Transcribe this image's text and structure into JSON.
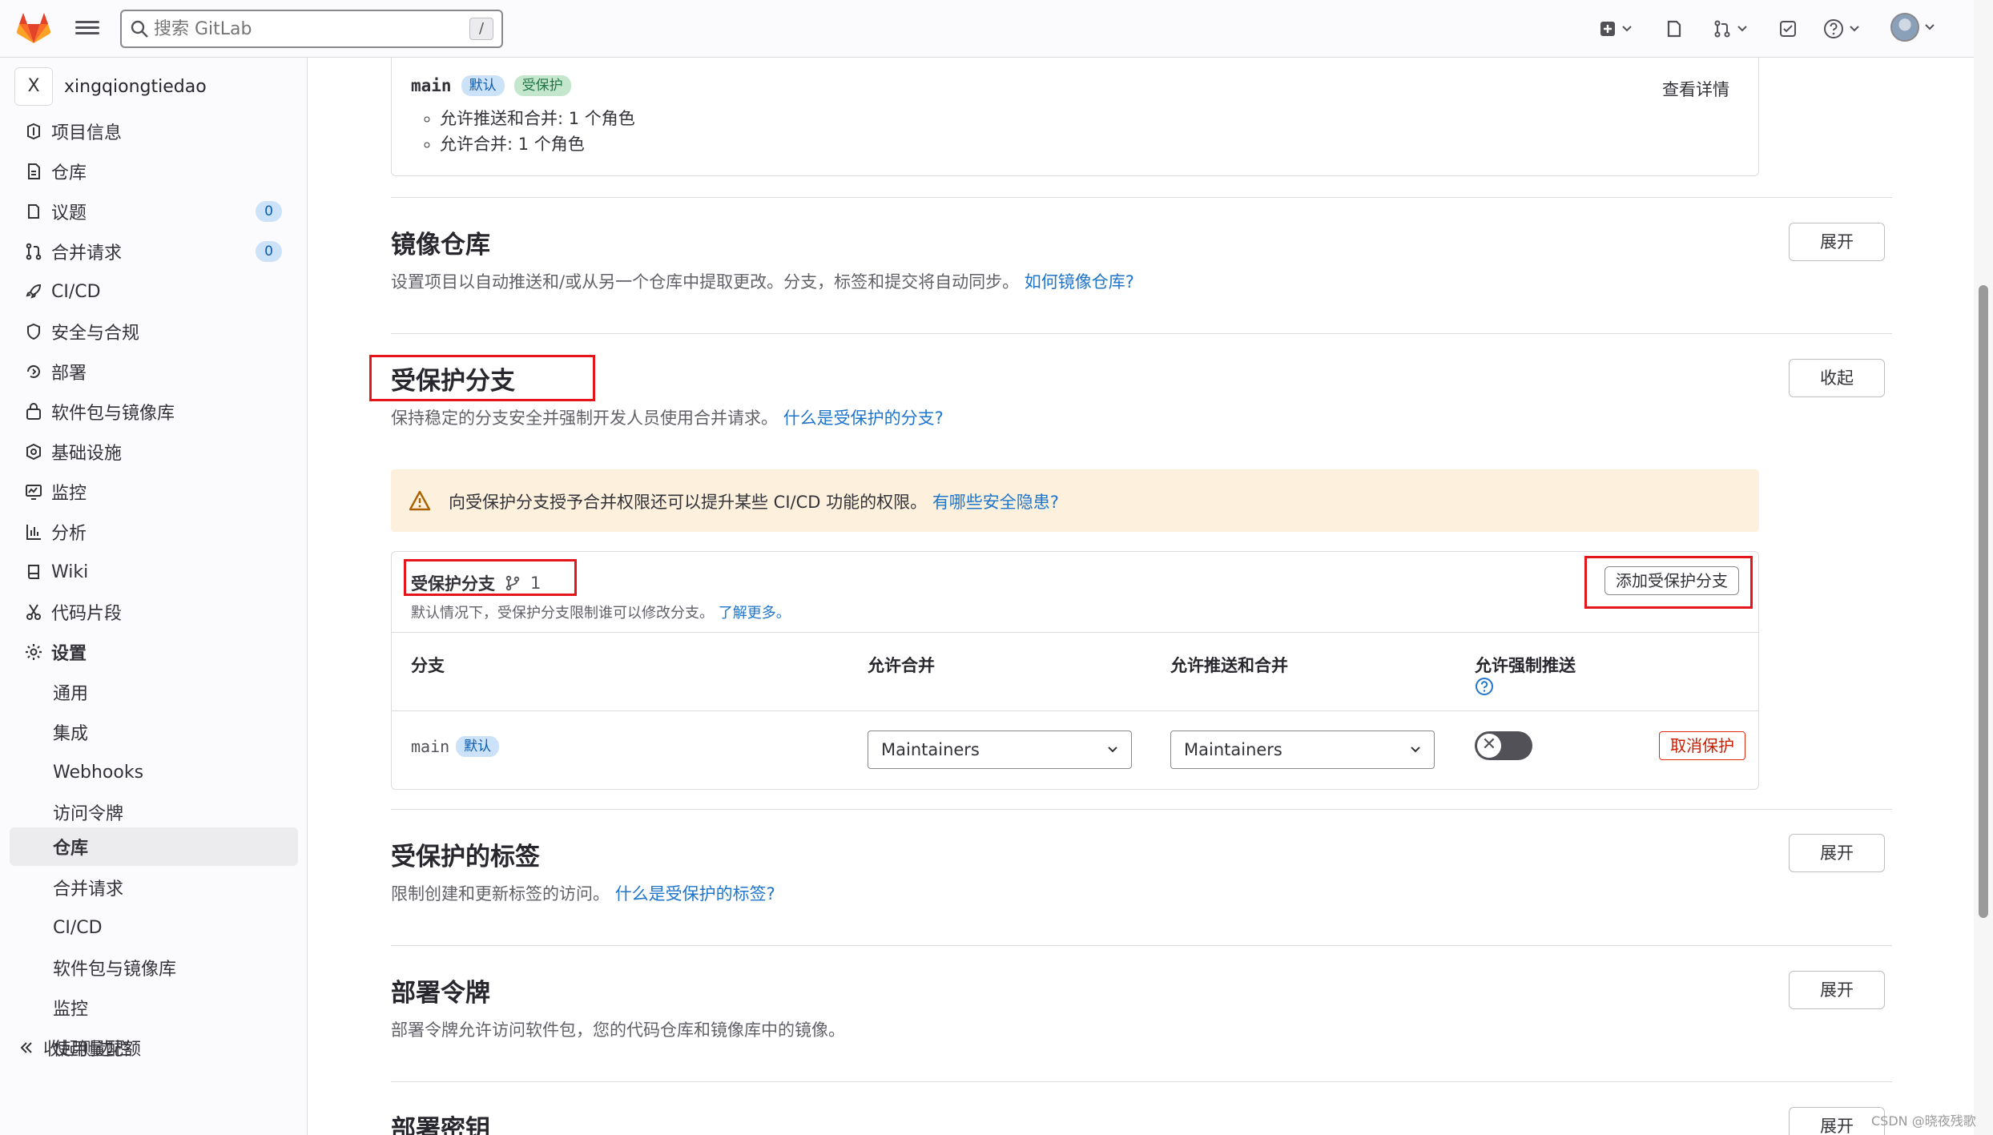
{
  "topbar": {
    "search_placeholder": "搜索 GitLab",
    "search_shortcut": "/",
    "colors": {
      "logo_orange": "#e24329",
      "logo_light": "#fc6d26",
      "logo_yellow": "#fca326"
    }
  },
  "sidebar": {
    "project_initial": "X",
    "project_name": "xingqiongtiedao",
    "items": [
      {
        "label": "项目信息",
        "icon": "info-icon"
      },
      {
        "label": "仓库",
        "icon": "document-icon"
      },
      {
        "label": "议题",
        "icon": "issues-icon",
        "badge": "0"
      },
      {
        "label": "合并请求",
        "icon": "merge-request-icon",
        "badge": "0"
      },
      {
        "label": "CI/CD",
        "icon": "rocket-icon"
      },
      {
        "label": "安全与合规",
        "icon": "shield-icon"
      },
      {
        "label": "部署",
        "icon": "deploy-icon"
      },
      {
        "label": "软件包与镜像库",
        "icon": "package-icon"
      },
      {
        "label": "基础设施",
        "icon": "cloud-gear-icon"
      },
      {
        "label": "监控",
        "icon": "monitor-icon"
      },
      {
        "label": "分析",
        "icon": "chart-icon"
      },
      {
        "label": "Wiki",
        "icon": "book-icon"
      },
      {
        "label": "代码片段",
        "icon": "scissors-icon"
      },
      {
        "label": "设置",
        "icon": "settings-icon"
      }
    ],
    "settings_sub": [
      "通用",
      "集成",
      "Webhooks",
      "访问令牌",
      "仓库",
      "合并请求",
      "CI/CD",
      "软件包与镜像库",
      "监控",
      "使用量配额"
    ],
    "collapse_label": "收起侧边栏"
  },
  "branch_card": {
    "branch": "main",
    "default_badge": "默认",
    "protected_badge": "受保护",
    "rules": [
      "允许推送和合并: 1 个角色",
      "允许合并: 1 个角色"
    ],
    "details_link": "查看详情"
  },
  "mirror": {
    "title": "镜像仓库",
    "desc": "设置项目以自动推送和/或从另一个仓库中提取更改。分支，标签和提交将自动同步。",
    "link": "如何镜像仓库?",
    "button": "展开"
  },
  "protected_branches": {
    "title": "受保护分支",
    "desc": "保持稳定的分支安全并强制开发人员使用合并请求。",
    "link": "什么是受保护的分支?",
    "button": "收起",
    "alert_text": "向受保护分支授予合并权限还可以提升某些 CI/CD 功能的权限。",
    "alert_link": "有哪些安全隐患?",
    "table_title": "受保护分支",
    "count": "1",
    "table_desc": "默认情况下，受保护分支限制谁可以修改分支。",
    "table_desc_link": "了解更多。",
    "add_button": "添加受保护分支",
    "headers": [
      "分支",
      "允许合并",
      "允许推送和合并",
      "允许强制推送"
    ],
    "row": {
      "branch": "main",
      "badge": "默认",
      "merge_select": "Maintainers",
      "push_select": "Maintainers",
      "force_push_enabled": false,
      "unprotect": "取消保护"
    }
  },
  "protected_tags": {
    "title": "受保护的标签",
    "desc": "限制创建和更新标签的访问。",
    "link": "什么是受保护的标签?",
    "button": "展开"
  },
  "deploy_tokens": {
    "title": "部署令牌",
    "desc": "部署令牌允许访问软件包，您的代码仓库和镜像库中的镜像。",
    "button": "展开"
  },
  "deploy_keys": {
    "title": "部署密钥",
    "button": "展开"
  },
  "watermark": "CSDN @晓夜残歌"
}
